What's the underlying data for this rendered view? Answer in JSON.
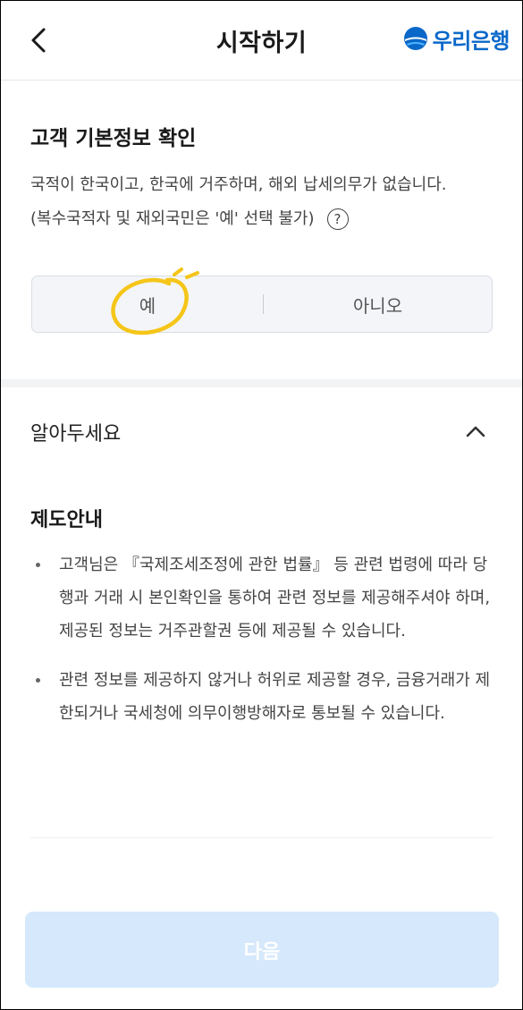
{
  "header": {
    "title": "시작하기",
    "logo_text": "우리은행",
    "back_icon": "chevron-left-icon",
    "logo_icon": "woori-logo-icon",
    "brand_color": "#0a68c9"
  },
  "basic_info": {
    "title": "고객 기본정보 확인",
    "description": "국적이 한국이고, 한국에 거주하며, 해외 납세의무가 없습니다.",
    "note": "(복수국적자 및 재외국민은 '예' 선택 불가)",
    "help_icon": "question-circle-icon",
    "options": {
      "yes": "예",
      "no": "아니오"
    },
    "annotation_color": "#f5c518"
  },
  "notice": {
    "title": "알아두세요",
    "expanded": true,
    "chevron_icon": "chevron-up-icon",
    "subtitle": "제도안내",
    "bullets": [
      "고객님은 『국제조세조정에 관한 법률』 등 관련 법령에 따라 당행과 거래 시 본인확인을 통하여 관련 정보를 제공해주셔야 하며, 제공된 정보는 거주관할권 등에 제공될 수 있습니다.",
      "관련 정보를 제공하지 않거나 허위로 제공할 경우, 금융거래가 제한되거나 국세청에 의무이행방해자로 통보될 수 있습니다."
    ]
  },
  "footer": {
    "next_label": "다음",
    "next_disabled": true,
    "button_color": "#d6e8fb"
  }
}
